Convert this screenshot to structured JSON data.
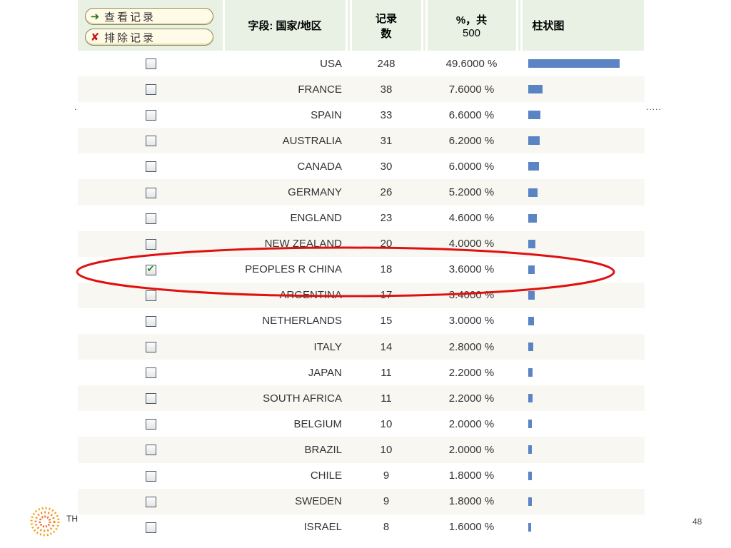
{
  "header": {
    "view_records_label": "查看记录",
    "exclude_records_label": "排除记录",
    "field_label": "字段: 国家/地区",
    "count_label_line1": "记录",
    "count_label_line2": "数",
    "pct_label_line1": "%，共",
    "pct_label_line2": "500",
    "bar_label": "柱状图"
  },
  "rows": [
    {
      "country": "USA",
      "count": "248",
      "pct": "49.6000 %",
      "share": 0.496,
      "checked": false
    },
    {
      "country": "FRANCE",
      "count": "38",
      "pct": "7.6000 %",
      "share": 0.076,
      "checked": false
    },
    {
      "country": "SPAIN",
      "count": "33",
      "pct": "6.6000 %",
      "share": 0.066,
      "checked": false
    },
    {
      "country": "AUSTRALIA",
      "count": "31",
      "pct": "6.2000 %",
      "share": 0.062,
      "checked": false
    },
    {
      "country": "CANADA",
      "count": "30",
      "pct": "6.0000 %",
      "share": 0.06,
      "checked": false
    },
    {
      "country": "GERMANY",
      "count": "26",
      "pct": "5.2000 %",
      "share": 0.052,
      "checked": false
    },
    {
      "country": "ENGLAND",
      "count": "23",
      "pct": "4.6000 %",
      "share": 0.046,
      "checked": false
    },
    {
      "country": "NEW ZEALAND",
      "count": "20",
      "pct": "4.0000 %",
      "share": 0.04,
      "checked": false
    },
    {
      "country": "PEOPLES R CHINA",
      "count": "18",
      "pct": "3.6000 %",
      "share": 0.036,
      "checked": true
    },
    {
      "country": "ARGENTINA",
      "count": "17",
      "pct": "3.4000 %",
      "share": 0.034,
      "checked": false
    },
    {
      "country": "NETHERLANDS",
      "count": "15",
      "pct": "3.0000 %",
      "share": 0.03,
      "checked": false
    },
    {
      "country": "ITALY",
      "count": "14",
      "pct": "2.8000 %",
      "share": 0.028,
      "checked": false
    },
    {
      "country": "JAPAN",
      "count": "11",
      "pct": "2.2000 %",
      "share": 0.022,
      "checked": false
    },
    {
      "country": "SOUTH AFRICA",
      "count": "11",
      "pct": "2.2000 %",
      "share": 0.022,
      "checked": false
    },
    {
      "country": "BELGIUM",
      "count": "10",
      "pct": "2.0000 %",
      "share": 0.02,
      "checked": false
    },
    {
      "country": "BRAZIL",
      "count": "10",
      "pct": "2.0000 %",
      "share": 0.02,
      "checked": false
    },
    {
      "country": "CHILE",
      "count": "9",
      "pct": "1.8000 %",
      "share": 0.018,
      "checked": false
    },
    {
      "country": "SWEDEN",
      "count": "9",
      "pct": "1.8000 %",
      "share": 0.018,
      "checked": false
    },
    {
      "country": "ISRAEL",
      "count": "8",
      "pct": "1.6000 %",
      "share": 0.016,
      "checked": false
    }
  ],
  "decor": {
    "dots_left": ".",
    "dots_right": ".....",
    "footer_text": "TH",
    "page_number": "48"
  },
  "colors": {
    "header_bg": "#e8f1e3",
    "bar": "#5b84c4",
    "highlight": "#e01010"
  },
  "icons": {
    "view": "arrow-right-icon",
    "exclude": "cross-icon"
  }
}
